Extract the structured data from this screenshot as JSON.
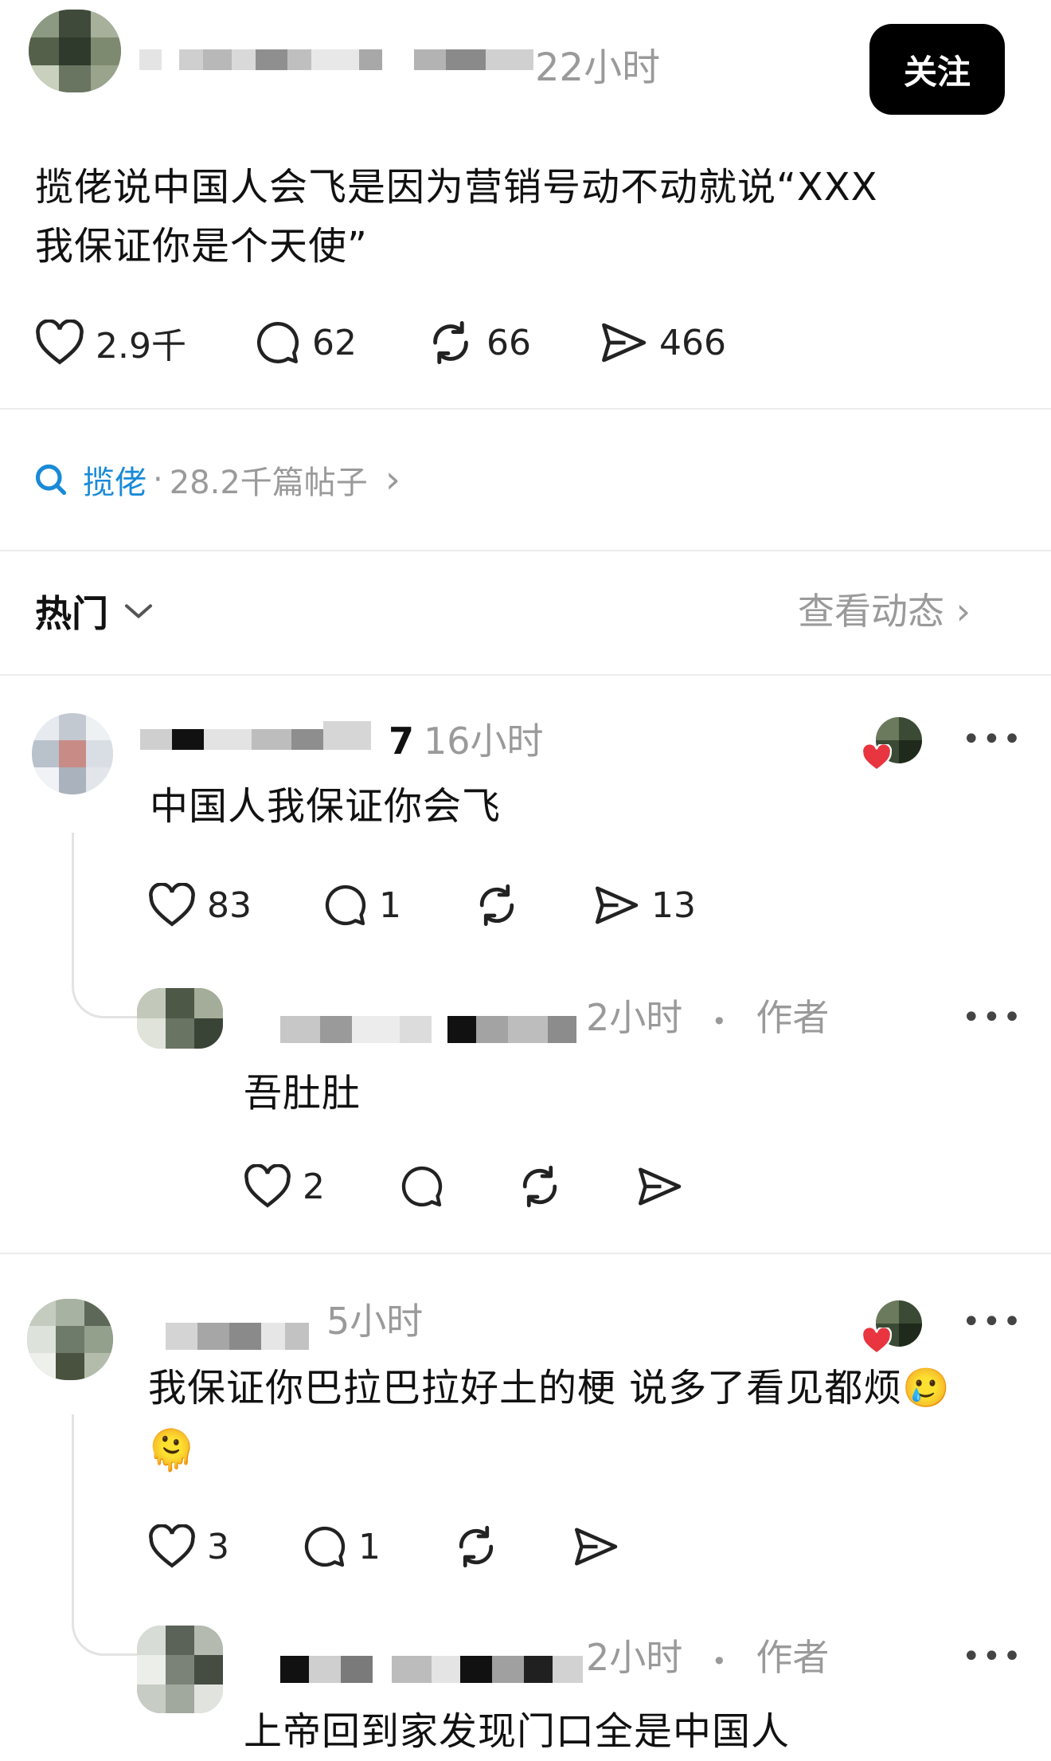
{
  "post": {
    "time": "22小时",
    "follow_label": "关注",
    "text_line1": "揽佬说中国人会飞是因为营销号动不动就说“XXX",
    "text_line2": "我保证你是个天使”",
    "likes": "2.9千",
    "comments": "62",
    "reposts": "66",
    "shares": "466"
  },
  "topic": {
    "name": "揽佬",
    "sep": "·",
    "count": "28.2千篇帖子",
    "chevron": "›"
  },
  "sort": {
    "label": "热门",
    "chevron": "⌄",
    "view_activity": "查看动态 ›"
  },
  "comments": [
    {
      "name_tail": "7",
      "time": "16小时",
      "text": "中国人我保证你会飞",
      "likes": "83",
      "replies": "1",
      "shares": "13",
      "reply": {
        "time": "2小时",
        "dot": "•",
        "badge": "作者",
        "text": "吾肚肚",
        "likes": "2"
      }
    },
    {
      "time": "5小时",
      "text": "我保证你巴拉巴拉好土的梗 说多了看见都烦",
      "emoji1": "🥲",
      "emoji2": "🫠",
      "likes": "3",
      "replies": "1",
      "reply": {
        "time": "2小时",
        "dot": "•",
        "badge": "作者",
        "text": "上帝回到家发现门口全是中国人"
      }
    }
  ],
  "more_icon": "•••",
  "colors": {
    "link_blue": "#1a8ad8",
    "follow_bg": "#000000",
    "heart_red": "#e8353f",
    "muted": "#9a9a9a"
  }
}
